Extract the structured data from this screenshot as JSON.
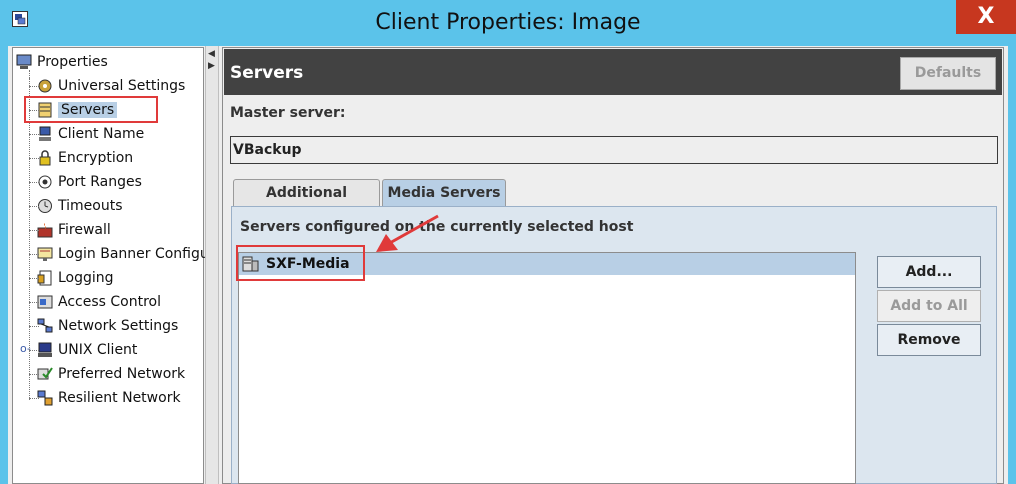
{
  "window": {
    "title": "Client Properties: Image",
    "close_label": "X"
  },
  "tree": {
    "items": [
      {
        "label": "Properties",
        "icon": "computer-icon"
      },
      {
        "label": "Universal Settings",
        "icon": "settings-icon"
      },
      {
        "label": "Servers",
        "icon": "server-icon"
      },
      {
        "label": "Client Name",
        "icon": "client-icon"
      },
      {
        "label": "Encryption",
        "icon": "lock-icon"
      },
      {
        "label": "Port Ranges",
        "icon": "port-icon"
      },
      {
        "label": "Timeouts",
        "icon": "clock-icon"
      },
      {
        "label": "Firewall",
        "icon": "firewall-icon"
      },
      {
        "label": "Login Banner Configu",
        "icon": "banner-icon"
      },
      {
        "label": "Logging",
        "icon": "logging-icon"
      },
      {
        "label": "Access Control",
        "icon": "access-control-icon"
      },
      {
        "label": "Network Settings",
        "icon": "network-icon"
      },
      {
        "label": "UNIX Client",
        "icon": "unix-client-icon"
      },
      {
        "label": "Preferred Network",
        "icon": "preferred-network-icon"
      },
      {
        "label": "Resilient Network",
        "icon": "resilient-network-icon"
      }
    ],
    "selected": "Servers"
  },
  "panel": {
    "title": "Servers",
    "defaults_label": "Defaults",
    "master_label": "Master server:",
    "master_value": "VBackup",
    "tabs": [
      {
        "label": "Additional Servers",
        "active": false
      },
      {
        "label": "Media Servers",
        "active": true
      }
    ],
    "list_caption": "Servers configured on the currently selected host",
    "servers": [
      "SXF-Media"
    ],
    "buttons": {
      "add": "Add...",
      "add_to_all": "Add to All",
      "remove": "Remove"
    }
  },
  "colors": {
    "titlebar": "#5bc3ea",
    "close": "#c7371f",
    "header": "#424242",
    "selection": "#b8cfe5",
    "annotation": "#e03a3a"
  }
}
